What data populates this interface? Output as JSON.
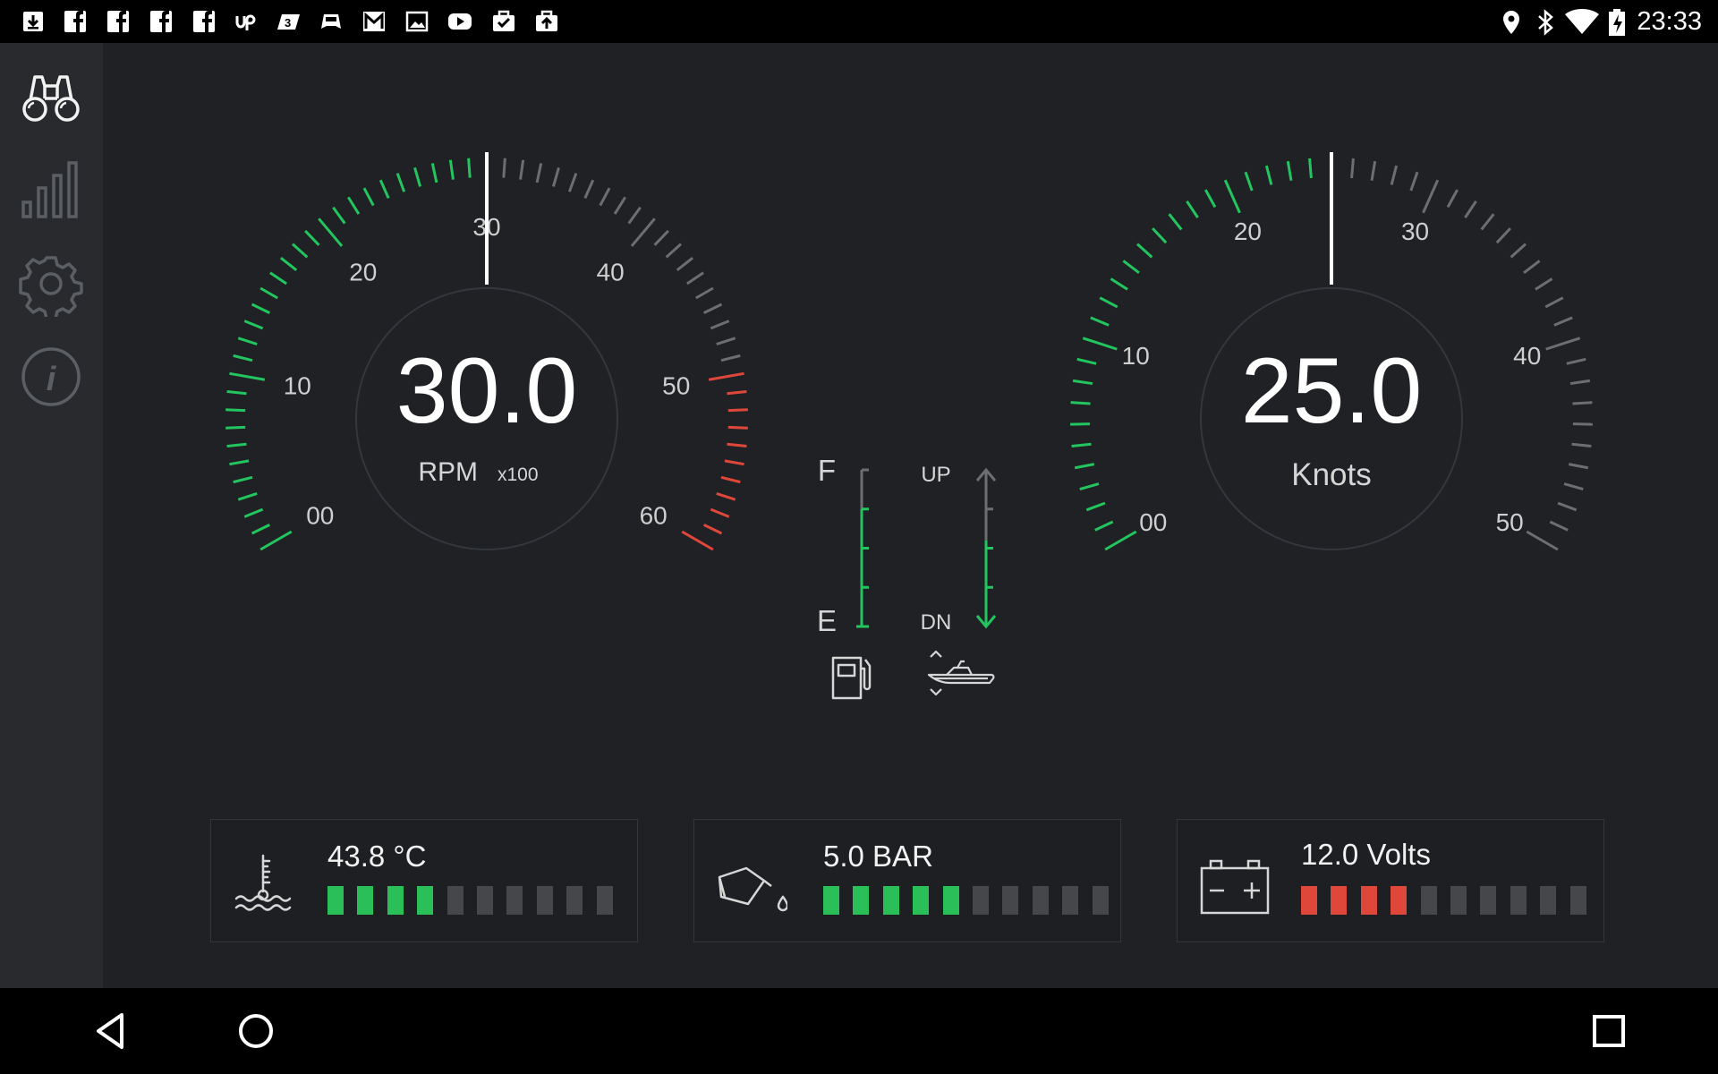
{
  "status_bar": {
    "time": "23:33",
    "notification_icons": [
      "download-icon",
      "facebook-icon",
      "facebook-icon",
      "facebook-icon",
      "facebook-icon",
      "upwork-icon",
      "app-3-icon",
      "gamepad-icon",
      "gmail-icon",
      "gallery-icon",
      "youtube-icon",
      "briefcase-check-icon",
      "briefcase-upload-icon"
    ],
    "right_icons": [
      "location-icon",
      "bluetooth-icon",
      "wifi-icon",
      "battery-charging-icon"
    ]
  },
  "sidebar": {
    "items": [
      {
        "icon": "binoculars-icon",
        "active": true
      },
      {
        "icon": "bar-chart-icon",
        "active": false
      },
      {
        "icon": "gear-icon",
        "active": false
      },
      {
        "icon": "info-icon",
        "active": false
      }
    ]
  },
  "rpm_gauge": {
    "value": "30.0",
    "unit": "RPM",
    "multiplier": "x100",
    "reading": 30,
    "scale_min": 0,
    "scale_max": 60,
    "redline_start": 50,
    "tick_labels": [
      "00",
      "10",
      "20",
      "30",
      "40",
      "50",
      "60"
    ],
    "colors": {
      "green": "#22c55e",
      "red": "#e0473b",
      "gray": "#6c6e72"
    }
  },
  "speed_gauge": {
    "value": "25.0",
    "unit": "Knots",
    "reading": 25,
    "scale_min": 0,
    "scale_max": 50,
    "tick_labels": [
      "00",
      "10",
      "20",
      "30",
      "40",
      "50"
    ],
    "colors": {
      "green": "#22c55e",
      "gray": "#6c6e72"
    }
  },
  "fuel": {
    "full_label": "F",
    "empty_label": "E",
    "level": 0.75,
    "icon": "fuel-pump-icon"
  },
  "trim": {
    "up_label": "UP",
    "down_label": "DN",
    "level": 0.55,
    "icon": "boat-trim-icon"
  },
  "indicators": [
    {
      "name": "temperature",
      "icon": "water-temperature-icon",
      "value": "43.8 °C",
      "segments_total": 10,
      "segments_on": 4,
      "color": "#2bbf5a"
    },
    {
      "name": "oil-pressure",
      "icon": "oil-can-icon",
      "value": "5.0 BAR",
      "segments_total": 10,
      "segments_on": 5,
      "color": "#2bbf5a"
    },
    {
      "name": "battery",
      "icon": "battery-icon",
      "value": "12.0 Volts",
      "segments_total": 10,
      "segments_on": 4,
      "color": "#e0473b"
    }
  ],
  "nav_bar": {
    "buttons": [
      "back-icon",
      "home-icon",
      "recents-icon"
    ]
  }
}
